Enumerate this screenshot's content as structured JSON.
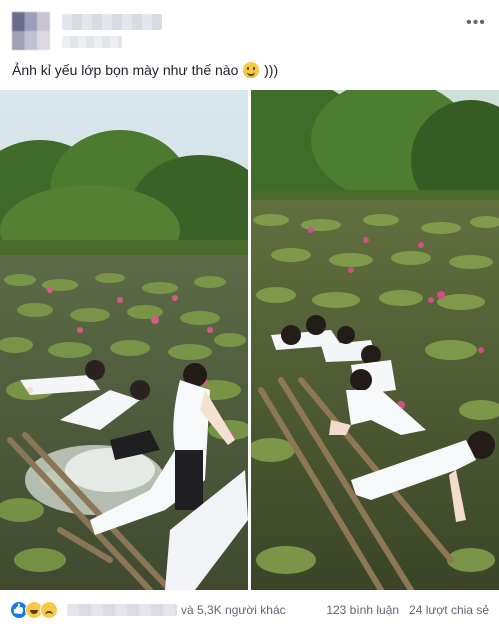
{
  "post": {
    "caption": "Ảnh kỉ yếu lớp bọn mày như thế nào",
    "caption_suffix": ")))",
    "more_label": "•••"
  },
  "footer": {
    "reactions_suffix": "và 5,3K người khác",
    "comments": "123 bình luận",
    "shares": "24 lượt chia sẻ"
  },
  "icons": [
    "more-icon",
    "smile-emoji-icon",
    "like-reaction-icon",
    "haha-reaction-icon",
    "sad-reaction-icon"
  ],
  "colors": {
    "like": "#1877f2",
    "text": "#1d2129",
    "meta": "#606770"
  }
}
